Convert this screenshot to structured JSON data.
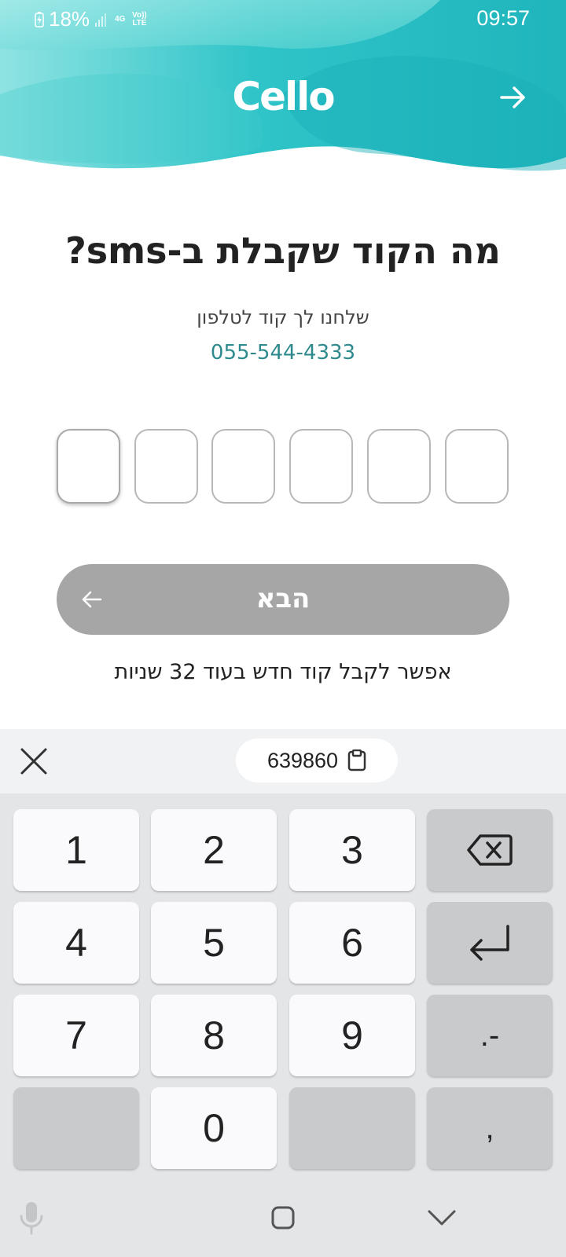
{
  "status_bar": {
    "battery": "18%",
    "network": "4G",
    "volte": "Vo)) LTE",
    "time": "09:57"
  },
  "header": {
    "logo": "Cello"
  },
  "main": {
    "title": "מה הקוד שקבלת ב-sms?",
    "subtitle": "שלחנו לך קוד לטלפון",
    "phone": "055-544-4333",
    "code_boxes": 6,
    "next_label": "הבא",
    "resend_text": "אפשר לקבל קוד חדש בעוד 32 שניות"
  },
  "keyboard": {
    "clipboard_value": "639860",
    "keys": {
      "k1": "1",
      "k2": "2",
      "k3": "3",
      "k4": "4",
      "k5": "5",
      "k6": "6",
      "k7": "7",
      "k8": "8",
      "k9": "9",
      "k0": "0",
      "dot_dash": ".-",
      "comma": ","
    }
  },
  "colors": {
    "brand_teal": "#2bbfc4",
    "phone_text": "#2f8a8e",
    "button_disabled": "#a6a6a6"
  }
}
